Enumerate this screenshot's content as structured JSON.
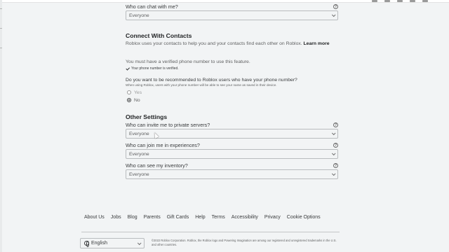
{
  "chat": {
    "label": "Who can chat with me?",
    "value": "Everyone"
  },
  "contacts": {
    "title": "Connect With Contacts",
    "description": "Roblox uses your contacts to help you and your contacts find each other on Roblox.",
    "learn_more": "Learn more",
    "verify_note": "You must have a verified phone number to use this feature.",
    "verified_text": "Your phone number is verified.",
    "question": "Do you want to be recommended to Roblox users who have your phone number?",
    "question_sub": "When using Roblox, users with your phone number will be able to see your name as saved in their device.",
    "options": [
      {
        "label": "Yes",
        "selected": false
      },
      {
        "label": "No",
        "selected": true
      }
    ]
  },
  "other": {
    "title": "Other Settings",
    "fields": [
      {
        "label": "Who can invite me to private servers?",
        "value": "Everyone"
      },
      {
        "label": "Who can join me in experiences?",
        "value": "Everyone"
      },
      {
        "label": "Who can see my inventory?",
        "value": "Everyone"
      }
    ]
  },
  "footer": {
    "links": [
      "About Us",
      "Jobs",
      "Blog",
      "Parents",
      "Gift Cards",
      "Help",
      "Terms",
      "Accessibility",
      "Privacy",
      "Cookie Options"
    ],
    "language": "English",
    "copyright": "©2022 Roblox Corporation. Roblox, the Roblox logo and Powering Imagination are among our registered and unregistered trademarks in the U.S. and other countries."
  },
  "icons": {
    "help": "help-circle-icon",
    "dropdown": "chevron-down-icon",
    "check": "check-icon",
    "globe": "globe-icon"
  },
  "colors": {
    "background": "#f2f4f5",
    "text": "#393b3d",
    "border": "#b9bcbe"
  }
}
